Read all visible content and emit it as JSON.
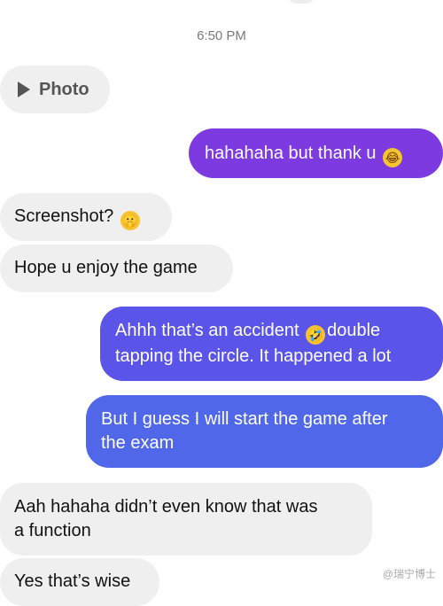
{
  "timestamp": "6:50 PM",
  "messages": [
    {
      "text": "Photo",
      "icon": "play-icon"
    },
    {
      "text": "hahahaha but thank u",
      "emoji": "😂"
    },
    {
      "text": "Screenshot?",
      "emoji": "🤫"
    },
    {
      "text": "Hope u enjoy the game"
    },
    {
      "line1_pre": "Ahhh that’s an accident",
      "emoji": "🤣",
      "line1_post": "double",
      "line2": "tapping the circle. It happened a lot"
    },
    {
      "line1": "But I guess I will start the game after",
      "line2": "the exam"
    },
    {
      "line1": "Aah hahaha didn’t even know that was",
      "line2": "a function"
    },
    {
      "text": "Yes that’s wise"
    }
  ],
  "watermark": "@瑞宁博士",
  "colors": {
    "incoming_bubble": "#efefef",
    "outgoing_purple": "#7c3ae0",
    "outgoing_indigo": "#5b54e8",
    "outgoing_blue": "#4f67e8",
    "timestamp": "#7a7a7a"
  }
}
